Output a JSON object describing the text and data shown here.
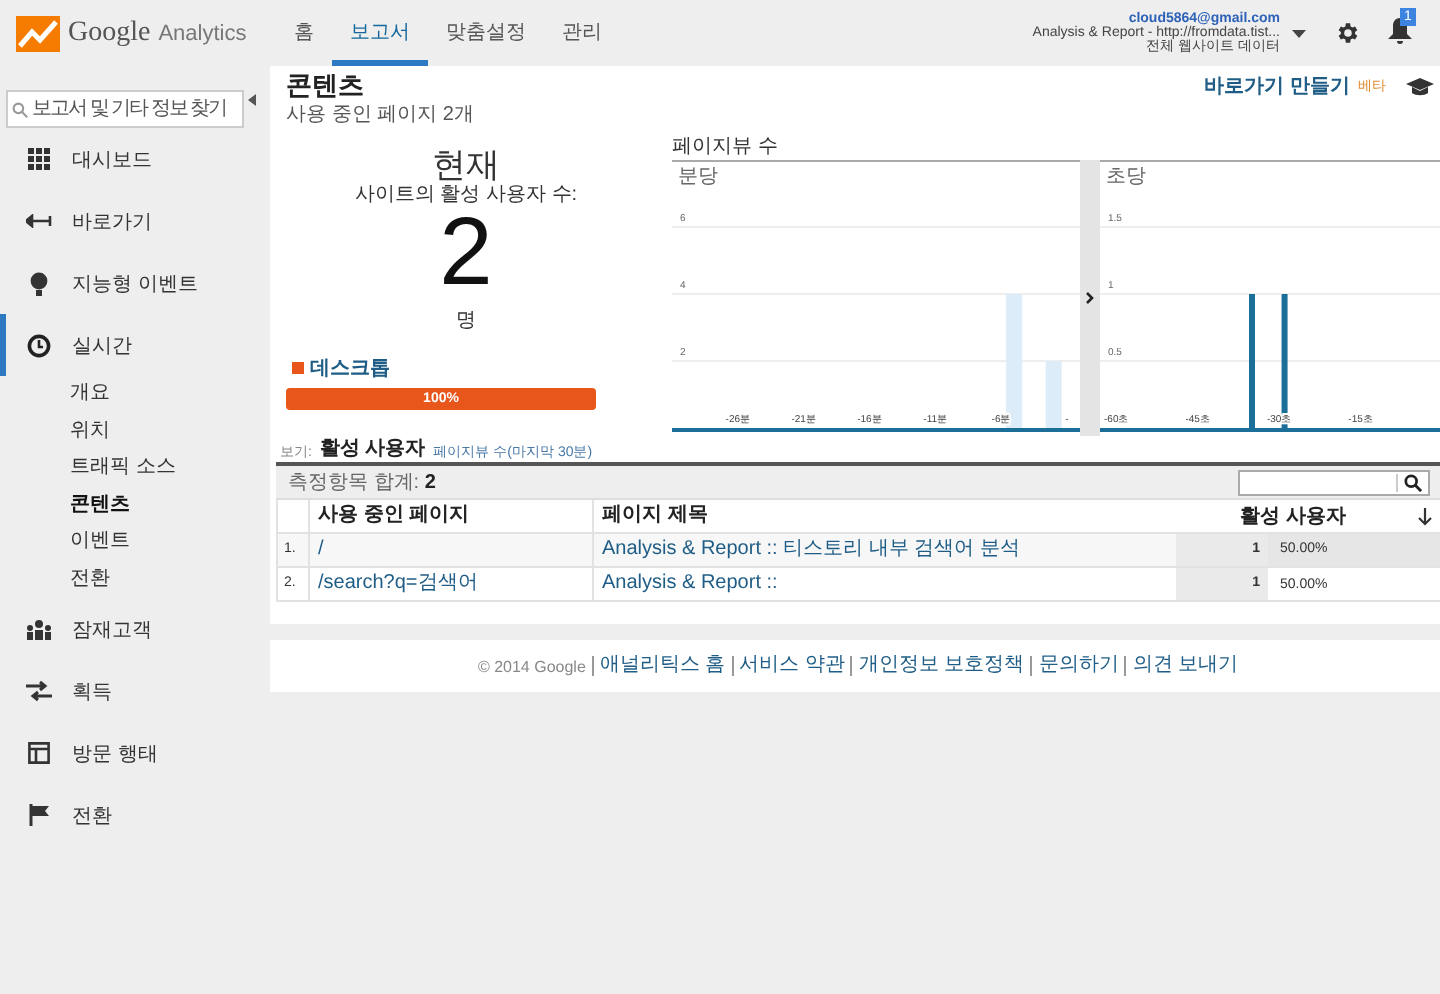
{
  "header": {
    "brand": "Google",
    "product": "Analytics",
    "nav": [
      {
        "label": "홈",
        "selected": false
      },
      {
        "label": "보고서",
        "selected": true
      },
      {
        "label": "맞춤설정",
        "selected": false
      },
      {
        "label": "관리",
        "selected": false
      }
    ],
    "account": {
      "email": "cloud5864@gmail.com",
      "property": "Analysis & Report - http://fromdata.tist...",
      "view": "전체 웹사이트 데이터"
    },
    "notification_count": "1"
  },
  "sidebar": {
    "search": {
      "placeholder": "보고서 및 기타 정보 찾기"
    },
    "items": [
      {
        "label": "대시보드",
        "selected": false
      },
      {
        "label": "바로가기",
        "selected": false
      },
      {
        "label": "지능형 이벤트",
        "selected": false
      },
      {
        "label": "실시간",
        "selected": true,
        "children": [
          {
            "label": "개요",
            "selected": false
          },
          {
            "label": "위치",
            "selected": false
          },
          {
            "label": "트래픽 소스",
            "selected": false
          },
          {
            "label": "콘텐츠",
            "selected": true
          },
          {
            "label": "이벤트",
            "selected": false
          },
          {
            "label": "전환",
            "selected": false
          }
        ]
      },
      {
        "label": "잠재고객",
        "selected": false
      },
      {
        "label": "획득",
        "selected": false
      },
      {
        "label": "방문 행태",
        "selected": false
      },
      {
        "label": "전환",
        "selected": false
      }
    ]
  },
  "report": {
    "title": "콘텐츠",
    "subtitle": "사용 중인 페이지 2개",
    "shortcut": "바로가기 만들기",
    "shortcut_badge": "베타",
    "now": {
      "heading": "현재",
      "caption": "사이트의 활성 사용자 수:",
      "count": "2",
      "unit": "명",
      "devices": [
        {
          "label": "데스크톱",
          "color": "#e8561b",
          "level": 1,
          "reading": "100%"
        }
      ]
    },
    "pageviews": {
      "title": "페이지뷰 수",
      "charts": [
        {
          "chart_data": {
            "type": "bar",
            "title": "분당",
            "x": [
              -5,
              -2
            ],
            "values": [
              4,
              2
            ],
            "xlim": [
              -31,
              0
            ],
            "ylim": [
              0,
              8
            ],
            "grid": true,
            "yticks": [
              2,
              4,
              6
            ],
            "xticks": [
              {
                "value": -26,
                "label": "-26분"
              },
              {
                "value": -21,
                "label": "-21분"
              },
              {
                "value": -16,
                "label": "-16분"
              },
              {
                "value": -11,
                "label": "-11분"
              },
              {
                "value": -6,
                "label": "-6분"
              },
              {
                "value": -1,
                "label": "-"
              }
            ]
          }
        },
        {
          "chart_data": {
            "type": "bar",
            "title": "초당",
            "x": [
              -35,
              -29
            ],
            "values": [
              1,
              1
            ],
            "xlim": [
              -63,
              0
            ],
            "ylim": [
              0,
              2
            ],
            "grid": true,
            "yticks": [
              0.5,
              1,
              1.5
            ],
            "xticks": [
              {
                "value": -60,
                "label": "-60초"
              },
              {
                "value": -45,
                "label": "-45초"
              },
              {
                "value": -30,
                "label": "-30초"
              },
              {
                "value": -15,
                "label": "-15초"
              }
            ]
          }
        }
      ]
    },
    "view_label": "보기:",
    "view_tabs": [
      {
        "label": "활성 사용자",
        "selected": true
      },
      {
        "label": "페이지뷰 수(마지막 30분)",
        "selected": false
      }
    ],
    "table": {
      "total_label": "측정항목 합계:",
      "total": "2",
      "columns": [
        "사용 중인 페이지",
        "페이지 제목",
        "활성 사용자"
      ],
      "rows": [
        {
          "index": "1.",
          "page": "/",
          "title": "Analysis & Report :: 티스토리 내부 검색어 분석",
          "count": "1",
          "share": "50.00%"
        },
        {
          "index": "2.",
          "page": "/search?q=검색어",
          "title": "Analysis & Report ::",
          "count": "1",
          "share": "50.00%"
        }
      ]
    }
  },
  "footer": {
    "copyright": "© 2014 Google",
    "links": [
      "애널리틱스 홈",
      "서비스 약관",
      "개인정보 보호정책",
      "문의하기",
      "의견 보내기"
    ]
  }
}
